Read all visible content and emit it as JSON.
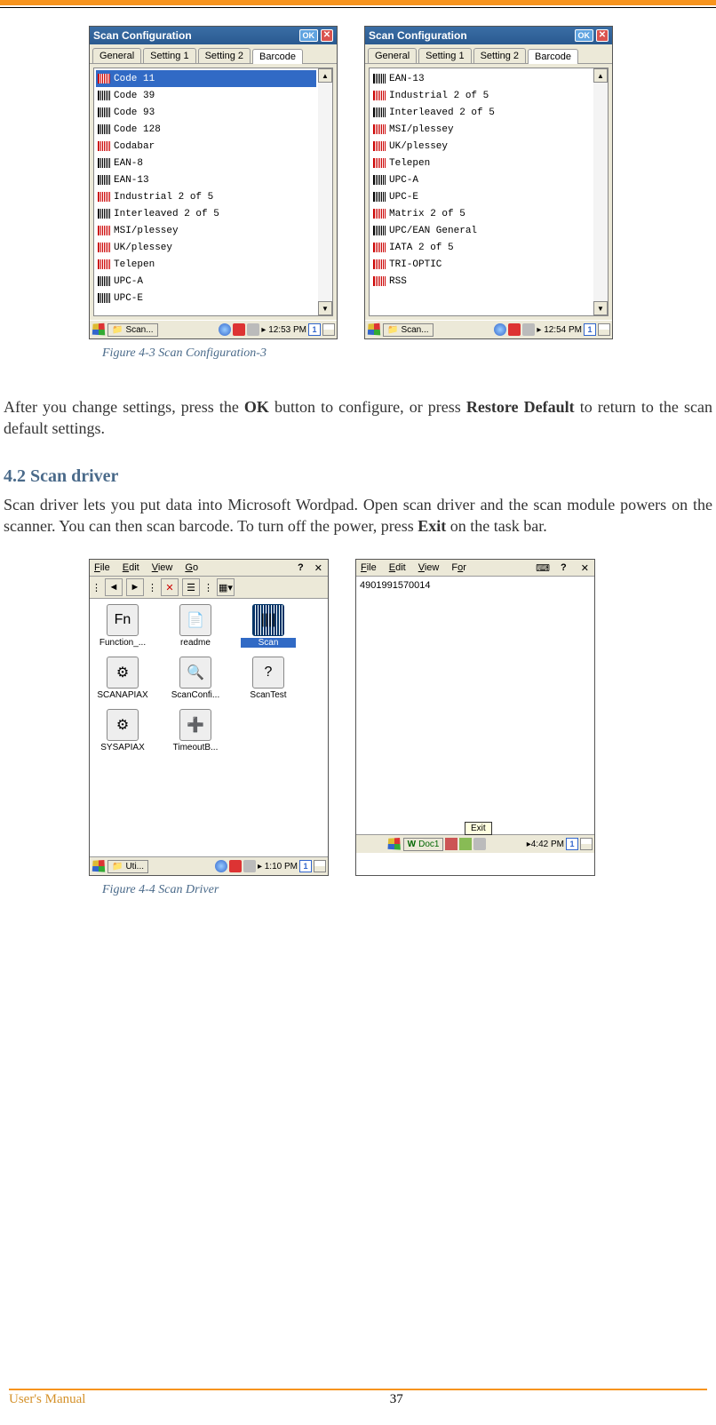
{
  "topFigure": {
    "left": {
      "title": "Scan Configuration",
      "okLabel": "OK",
      "tabs": [
        "General",
        "Setting 1",
        "Setting 2",
        "Barcode"
      ],
      "activeTab": 3,
      "items": [
        {
          "name": "Code 11",
          "red": true,
          "selected": true
        },
        {
          "name": "Code 39",
          "red": false
        },
        {
          "name": "Code 93",
          "red": false
        },
        {
          "name": "Code 128",
          "red": false
        },
        {
          "name": "Codabar",
          "red": true
        },
        {
          "name": "EAN-8",
          "red": false
        },
        {
          "name": "EAN-13",
          "red": false
        },
        {
          "name": "Industrial 2 of 5",
          "red": true
        },
        {
          "name": "Interleaved 2 of 5",
          "red": false
        },
        {
          "name": "MSI/plessey",
          "red": true
        },
        {
          "name": "UK/plessey",
          "red": true
        },
        {
          "name": "Telepen",
          "red": true
        },
        {
          "name": "UPC-A",
          "red": false
        },
        {
          "name": "UPC-E",
          "red": false
        }
      ],
      "taskLabel": "Scan...",
      "time": "12:53 PM",
      "kb": "1"
    },
    "right": {
      "title": "Scan Configuration",
      "okLabel": "OK",
      "tabs": [
        "General",
        "Setting 1",
        "Setting 2",
        "Barcode"
      ],
      "activeTab": 3,
      "items": [
        {
          "name": "EAN-13",
          "red": false
        },
        {
          "name": "Industrial 2 of 5",
          "red": true
        },
        {
          "name": "Interleaved 2 of 5",
          "red": false
        },
        {
          "name": "MSI/plessey",
          "red": true
        },
        {
          "name": "UK/plessey",
          "red": true
        },
        {
          "name": "Telepen",
          "red": true
        },
        {
          "name": "UPC-A",
          "red": false
        },
        {
          "name": "UPC-E",
          "red": false
        },
        {
          "name": "Matrix 2 of 5",
          "red": true
        },
        {
          "name": "UPC/EAN General",
          "red": false
        },
        {
          "name": "IATA 2 of 5",
          "red": true
        },
        {
          "name": "TRI-OPTIC",
          "red": true
        },
        {
          "name": "RSS",
          "red": true
        }
      ],
      "taskLabel": "Scan...",
      "time": "12:54 PM",
      "kb": "1"
    },
    "caption": "Figure 4-3 Scan Configuration-3"
  },
  "para1_a": "After you change settings, press the ",
  "para1_b": "OK",
  "para1_c": " button to configure, or press ",
  "para1_d": "Restore Default",
  "para1_e": " to return to the scan default settings.",
  "section": "4.2  Scan driver",
  "para2_a": "Scan driver lets you put data into Microsoft Wordpad. Open scan driver and the scan module powers on the scanner. You can then scan barcode. To turn off the power, press ",
  "para2_b": "Exit",
  "para2_c": " on the task bar.",
  "bottomFigure": {
    "left": {
      "menus": [
        "File",
        "Edit",
        "View",
        "Go"
      ],
      "icons": [
        {
          "label": "Function_...",
          "glyph": "Fn",
          "sel": false
        },
        {
          "label": "readme",
          "glyph": "📄",
          "sel": false
        },
        {
          "label": "Scan",
          "glyph": "||||",
          "sel": true
        },
        {
          "label": "SCANAPIAX",
          "glyph": "⚙",
          "sel": false
        },
        {
          "label": "ScanConfi...",
          "glyph": "🔍",
          "sel": false
        },
        {
          "label": "ScanTest",
          "glyph": "?",
          "sel": false
        },
        {
          "label": "SYSAPIAX",
          "glyph": "⚙",
          "sel": false
        },
        {
          "label": "TimeoutB...",
          "glyph": "➕",
          "sel": false
        }
      ],
      "taskLabel": "Uti...",
      "time": "1:10 PM",
      "kb": "1"
    },
    "right": {
      "menus": [
        "File",
        "Edit",
        "View",
        "For"
      ],
      "content": "4901991570014",
      "tooltip": "Exit",
      "taskLabel": "Doc1",
      "time": "4:42 PM",
      "kb": "1"
    },
    "caption": "Figure 4-4 Scan Driver"
  },
  "footer": {
    "left": "User's Manual",
    "center": "37"
  }
}
